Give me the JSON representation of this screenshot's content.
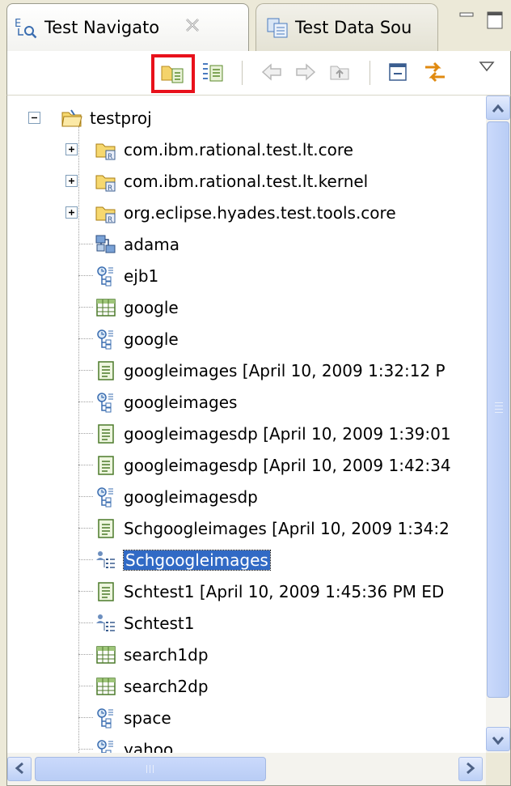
{
  "tabs": [
    {
      "label": "Test Navigato",
      "active": true,
      "icon": "test-navigator-icon"
    },
    {
      "label": "Test Data Sou",
      "active": false,
      "icon": "test-data-source-icon"
    }
  ],
  "toolbar": {
    "buttons": [
      {
        "name": "new-test-element-button",
        "icon": "folder-test-icon",
        "highlighted": true
      },
      {
        "name": "new-test-element-variant-button",
        "icon": "test-list-icon",
        "highlighted": false
      },
      {
        "name": "back-button",
        "icon": "arrow-left-icon",
        "disabled": true
      },
      {
        "name": "forward-button",
        "icon": "arrow-right-icon",
        "disabled": true
      },
      {
        "name": "up-button",
        "icon": "up-folder-icon",
        "disabled": true
      },
      {
        "name": "collapse-all-button",
        "icon": "collapse-all-icon"
      },
      {
        "name": "link-with-editor-button",
        "icon": "link-arrows-icon"
      },
      {
        "name": "view-menu-button",
        "icon": "triangle-down-icon"
      }
    ],
    "highlight_color": "#e8111b"
  },
  "tree": {
    "items": [
      {
        "label": "testproj",
        "icon": "project-folder-icon",
        "expander": "minus"
      },
      {
        "label": "com.ibm.rational.test.lt.core",
        "icon": "package-folder-icon",
        "expander": "plus"
      },
      {
        "label": "com.ibm.rational.test.lt.kernel",
        "icon": "package-folder-icon",
        "expander": "plus"
      },
      {
        "label": "org.eclipse.hyades.test.tools.core",
        "icon": "package-folder-icon",
        "expander": "plus"
      },
      {
        "label": "adama",
        "icon": "deployment-icon"
      },
      {
        "label": "ejb1",
        "icon": "test-suite-icon"
      },
      {
        "label": "google",
        "icon": "datapool-icon"
      },
      {
        "label": "google",
        "icon": "test-suite-icon"
      },
      {
        "label": "googleimages [April 10, 2009 1:32:12 P",
        "icon": "test-log-icon"
      },
      {
        "label": "googleimages",
        "icon": "test-suite-icon"
      },
      {
        "label": "googleimagesdp [April 10, 2009 1:39:01",
        "icon": "test-log-icon"
      },
      {
        "label": "googleimagesdp [April 10, 2009 1:42:34",
        "icon": "test-log-icon"
      },
      {
        "label": "googleimagesdp",
        "icon": "test-suite-icon"
      },
      {
        "label": "Schgoogleimages [April 10, 2009 1:34:2",
        "icon": "test-log-icon"
      },
      {
        "label": "Schgoogleimages",
        "icon": "schedule-icon",
        "selected": true
      },
      {
        "label": "Schtest1 [April 10, 2009 1:45:36 PM ED",
        "icon": "test-log-icon"
      },
      {
        "label": "Schtest1",
        "icon": "schedule-icon"
      },
      {
        "label": "search1dp",
        "icon": "datapool-icon"
      },
      {
        "label": "search2dp",
        "icon": "datapool-icon"
      },
      {
        "label": "space",
        "icon": "test-suite-icon"
      },
      {
        "label": "yahoo",
        "icon": "test-suite-icon"
      }
    ],
    "selection_color": "#316ac5"
  }
}
